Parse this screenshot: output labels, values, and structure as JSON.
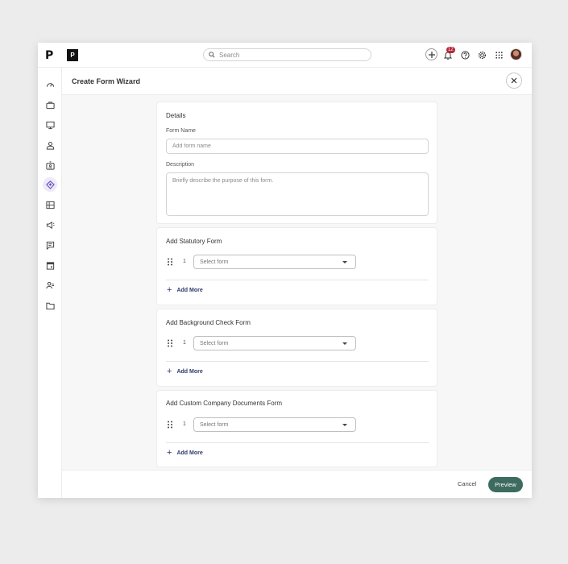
{
  "topbar": {
    "logo": "P",
    "brand": "P",
    "search": {
      "placeholder": "Search"
    },
    "notifications_count": "12"
  },
  "header": {
    "title": "Create Form Wizard"
  },
  "details": {
    "title": "Details",
    "form_name_label": "Form Name",
    "form_name_placeholder": "Add form name",
    "description_label": "Description",
    "description_placeholder": "Briefly describe the purpose of this form."
  },
  "sections": [
    {
      "title": "Add Statutory Form",
      "row_number": "1",
      "select_placeholder": "Select form",
      "add_more": "Add More"
    },
    {
      "title": "Add Background Check Form",
      "row_number": "1",
      "select_placeholder": "Select form",
      "add_more": "Add More"
    },
    {
      "title": "Add Custom Company Documents Form",
      "row_number": "1",
      "select_placeholder": "Select form",
      "add_more": "Add More"
    }
  ],
  "footer": {
    "cancel_label": "Cancel",
    "preview_label": "Preview"
  },
  "sidebar": {
    "items": [
      "dashboard-icon",
      "briefcase-icon",
      "monitor-icon",
      "person-icon",
      "id-badge-icon",
      "forms-icon",
      "table-icon",
      "megaphone-icon",
      "chat-icon",
      "calendar-icon",
      "team-icon",
      "folder-icon"
    ],
    "active": "forms-icon"
  },
  "colors": {
    "primary": "#3d6b60",
    "badge": "#b3263a",
    "accent": "#6a4fc8",
    "link": "#2f3a6b"
  }
}
